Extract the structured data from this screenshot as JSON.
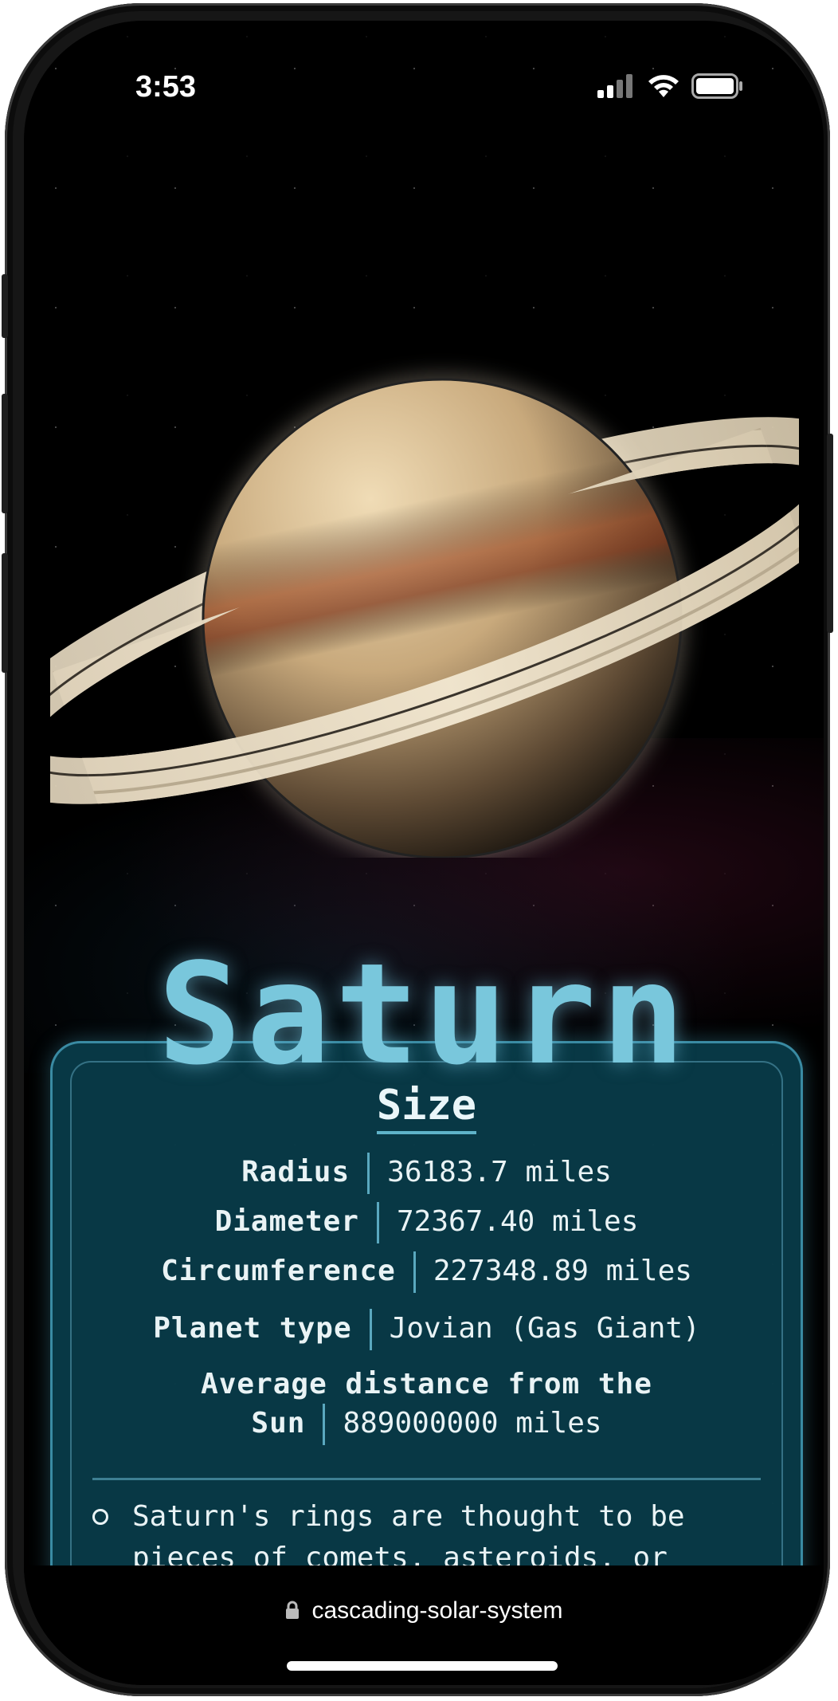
{
  "status_bar": {
    "time": "3:53",
    "signal_icon": "cellular-signal-icon",
    "wifi_icon": "wifi-icon",
    "battery_icon": "battery-icon"
  },
  "planet": {
    "name": "Saturn"
  },
  "size_card": {
    "heading": "Size",
    "rows": [
      {
        "label": "Radius",
        "value": "36183.7 miles"
      },
      {
        "label": "Diameter",
        "value": "72367.40 miles"
      },
      {
        "label": "Circumference",
        "value": "227348.89 miles"
      },
      {
        "label": "Planet type",
        "value": "Jovian (Gas Giant)"
      },
      {
        "label_line1": "Average distance from the",
        "label_line2": "Sun",
        "value": "889000000 miles"
      }
    ],
    "fact": "Saturn's rings are thought to be pieces of comets, asteroids, or"
  },
  "browser": {
    "url": "cascading-solar-system",
    "lock_icon": "lock-icon"
  },
  "colors": {
    "title": "#79c7dc",
    "card_bg": "#083a48",
    "card_border": "#3a8ba3"
  }
}
